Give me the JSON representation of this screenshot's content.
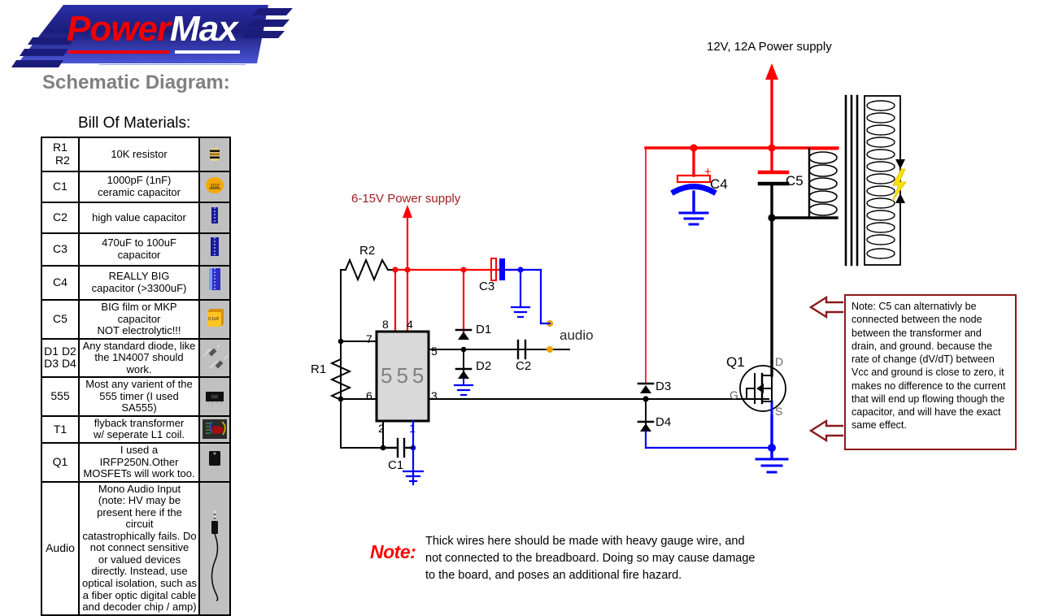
{
  "logo": {
    "word1": "Power",
    "word2": "Max",
    "colors": {
      "red": "#ee0000",
      "white": "#ffffff",
      "blue_dark": "#1b1c7a",
      "blue_light": "#3a46c8"
    }
  },
  "headings": {
    "schematic": "Schematic Diagram:",
    "bom": "Bill Of Materials:"
  },
  "bom": {
    "rows": [
      {
        "ref": "R1\nR2",
        "ref_lines": [
          "R1",
          "R2"
        ],
        "desc": "10K resistor",
        "icon": "resistor-icon"
      },
      {
        "ref": "C1",
        "ref_lines": [
          "C1"
        ],
        "desc": "1000pF (1nF)\nceramic capacitor",
        "desc_lines": [
          "1000pF (1nF)",
          "ceramic capacitor"
        ],
        "icon": "ceramic-capacitor-icon"
      },
      {
        "ref": "C2",
        "ref_lines": [
          "C2"
        ],
        "desc": "high value capacitor",
        "desc_lines": [
          "high value capacitor"
        ],
        "icon": "electrolytic-capacitor-icon"
      },
      {
        "ref": "C3",
        "ref_lines": [
          "C3"
        ],
        "desc": "470uF to 100uF\ncapacitor",
        "desc_lines": [
          "470uF to 100uF",
          "capacitor"
        ],
        "icon": "electrolytic-capacitor-icon"
      },
      {
        "ref": "C4",
        "ref_lines": [
          "C4"
        ],
        "desc": "REALLY BIG\ncapacitor (>3300uF)",
        "desc_lines": [
          "REALLY BIG",
          "capacitor (>3300uF)"
        ],
        "icon": "big-electrolytic-capacitor-icon"
      },
      {
        "ref": "C5",
        "ref_lines": [
          "C5"
        ],
        "desc": "BIG film or MKP capacitor\nNOT electrolytic!!!",
        "desc_lines": [
          "BIG film or MKP capacitor",
          "NOT electrolytic!!!"
        ],
        "icon": "film-capacitor-icon"
      },
      {
        "ref": "D1 D2\nD3 D4",
        "ref_lines": [
          "D1 D2",
          "D3 D4"
        ],
        "desc": "Any standard diode, like\nthe 1N4007 should work.",
        "desc_lines": [
          "Any standard diode, like",
          "the 1N4007 should work."
        ],
        "icon": "diode-icon"
      },
      {
        "ref": "555",
        "ref_lines": [
          "555"
        ],
        "desc": "Most any varient of the\n555 timer (I used  SA555)",
        "desc_lines": [
          "Most any varient of the",
          "555 timer (I used  SA555)"
        ],
        "icon": "ic-chip-icon"
      },
      {
        "ref": "T1",
        "ref_lines": [
          "T1"
        ],
        "desc": "flyback transformer\nw/ seperate L1 coil.",
        "desc_lines": [
          "flyback transformer",
          "w/ seperate L1 coil."
        ],
        "icon": "transformer-icon"
      },
      {
        "ref": "Q1",
        "ref_lines": [
          "Q1"
        ],
        "desc": "I used a IRFP250N.Other\nMOSFETs will work too.",
        "desc_lines": [
          "I used a IRFP250N.Other",
          "MOSFETs will work too."
        ],
        "icon": "mosfet-icon"
      },
      {
        "ref": "Audio",
        "ref_lines": [
          "Audio"
        ],
        "desc": "Mono Audio Input (note: HV may be present here if the circuit catastrophically fails. Do not connect sensitive or valued devices directly. Instead, use optical isolation, such as a fiber optic digital cable and decoder chip / amp)",
        "desc_lines": [
          "Mono Audio Input",
          "(note: HV may be",
          "present here if the circuit",
          "catastrophically fails. Do",
          "not connect sensitive",
          "or valued devices",
          "directly. Instead, use",
          "optical isolation, such as",
          "a fiber optic digital cable",
          "and decoder chip / amp)"
        ],
        "icon": "audio-jack-icon"
      }
    ]
  },
  "circuit": {
    "supply_low": "6-15V Power supply",
    "supply_high": "12V, 12A Power supply",
    "ic_label": "555",
    "audio_label": "audio",
    "components": {
      "r1": "R1",
      "r2": "R2",
      "c1": "C1",
      "c2": "C2",
      "c3": "C3",
      "c4": "C4",
      "c5": "C5",
      "d1": "D1",
      "d2": "D2",
      "d3": "D3",
      "d4": "D4",
      "q1": "Q1"
    },
    "mosfet_pins": {
      "drain": "D",
      "gate": "G",
      "source": "S"
    },
    "ic_pins": {
      "p1": "1",
      "p2": "2",
      "p3": "3",
      "p4": "4",
      "p5": "5",
      "p6": "6",
      "p7": "7",
      "p8": "8"
    },
    "colors": {
      "power_red": "#ff0000",
      "ground_blue": "#0000ff",
      "wire_black": "#000000",
      "supply_label_red": "#a02020",
      "audio_terminal": "#f0a000",
      "note_border": "#8b1a1a",
      "spark_yellow": "#ffe000"
    }
  },
  "note_box": {
    "text": "Note: C5 can alternativly be connected between the node between the transformer and drain, and ground. because the rate of change (dV/dT) between Vcc and ground is close to zero, it makes no difference to the current that will end up flowing though the capacitor, and will have the exact same effect."
  },
  "bottom_note": {
    "word": "Note:",
    "text": "Thick wires here should be made with heavy gauge wire, and not connected to the breadboard. Doing so may cause damage to the board, and poses an additional fire hazard."
  }
}
